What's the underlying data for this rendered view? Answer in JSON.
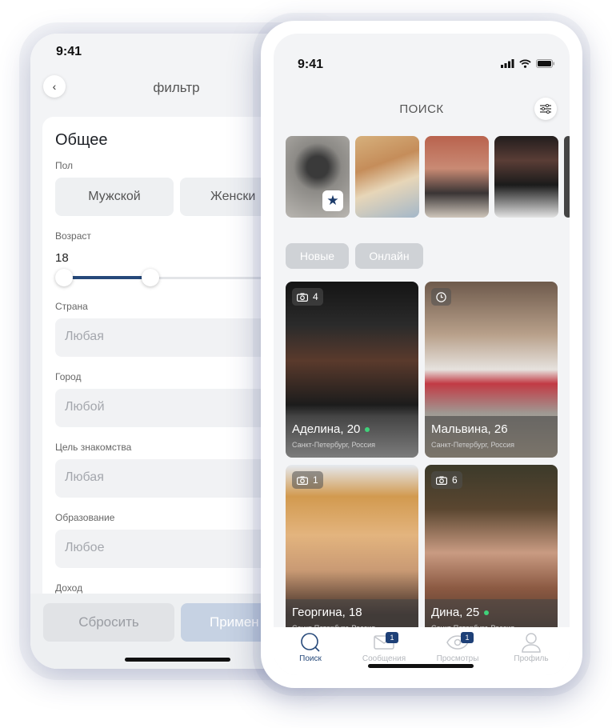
{
  "filter_screen": {
    "status_time": "9:41",
    "title": "фильтр",
    "section_title": "Общее",
    "gender": {
      "label": "Пол",
      "options": [
        "Мужской",
        "Женски"
      ]
    },
    "age": {
      "label": "Возраст",
      "value": "18",
      "range_fill": 0.37
    },
    "country": {
      "label": "Страна",
      "placeholder": "Любая"
    },
    "city": {
      "label": "Город",
      "placeholder": "Любой"
    },
    "goal": {
      "label": "Цель знакомства",
      "placeholder": "Любая"
    },
    "education": {
      "label": "Образование",
      "placeholder": "Любое"
    },
    "income": {
      "label": "Доход"
    },
    "reset_label": "Сбросить",
    "apply_label": "Примен"
  },
  "search_screen": {
    "status_time": "9:41",
    "title": "ПОИСК",
    "chips": [
      "Новые",
      "Онлайн"
    ],
    "profiles": [
      {
        "name": "Аделина, 20",
        "location": "Санкт-Петербург, Россия",
        "tag_icon": "camera-icon",
        "tag_count": "4",
        "online": true
      },
      {
        "name": "Мальвина, 26",
        "location": "Санкт-Петербург, Россия",
        "tag_icon": "clock-icon",
        "tag_count": "",
        "online": false
      },
      {
        "name": "Георгина, 18",
        "location": "Санкт-Петербург, Россия",
        "tag_icon": "camera-icon",
        "tag_count": "1",
        "online": false
      },
      {
        "name": "Дина, 25",
        "location": "Санкт-Петербург, Россия",
        "tag_icon": "camera-icon",
        "tag_count": "6",
        "online": true
      }
    ],
    "tabs": [
      {
        "label": "Поиск",
        "icon": "search-icon",
        "badge": ""
      },
      {
        "label": "Сообщения",
        "icon": "envelope-icon",
        "badge": "1"
      },
      {
        "label": "Просмотры",
        "icon": "eye-icon",
        "badge": "1"
      },
      {
        "label": "Профиль",
        "icon": "user-icon",
        "badge": ""
      }
    ],
    "colors": {
      "accent": "#26497a",
      "online": "#3fd27a"
    }
  }
}
